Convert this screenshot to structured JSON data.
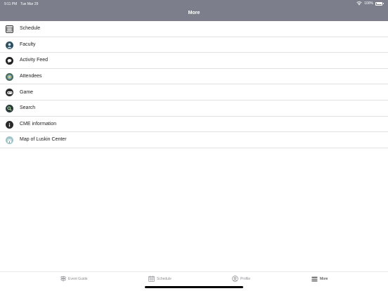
{
  "status_bar": {
    "time": "9:11 PM",
    "date": "Tue Mar 29",
    "battery": "100%"
  },
  "header": {
    "title": "More"
  },
  "menu": {
    "items": [
      {
        "label": "Schedule",
        "icon": "schedule-icon"
      },
      {
        "label": "Faculty",
        "icon": "faculty-icon"
      },
      {
        "label": "Activity Feed",
        "icon": "chat-bubble-icon"
      },
      {
        "label": "Attendees",
        "icon": "attendees-icon"
      },
      {
        "label": "Game",
        "icon": "gamepad-icon"
      },
      {
        "label": "Search",
        "icon": "search-icon"
      },
      {
        "label": "CME information",
        "icon": "info-icon"
      },
      {
        "label": "Map of Luskin Center",
        "icon": "map-icon"
      }
    ]
  },
  "tabbar": {
    "tabs": [
      {
        "label": "Event Guide",
        "icon": "event-guide-icon"
      },
      {
        "label": "Schedule",
        "icon": "calendar-icon"
      },
      {
        "label": "Profile",
        "icon": "profile-icon"
      },
      {
        "label": "More",
        "icon": "menu-lines-icon",
        "active": true
      }
    ]
  }
}
